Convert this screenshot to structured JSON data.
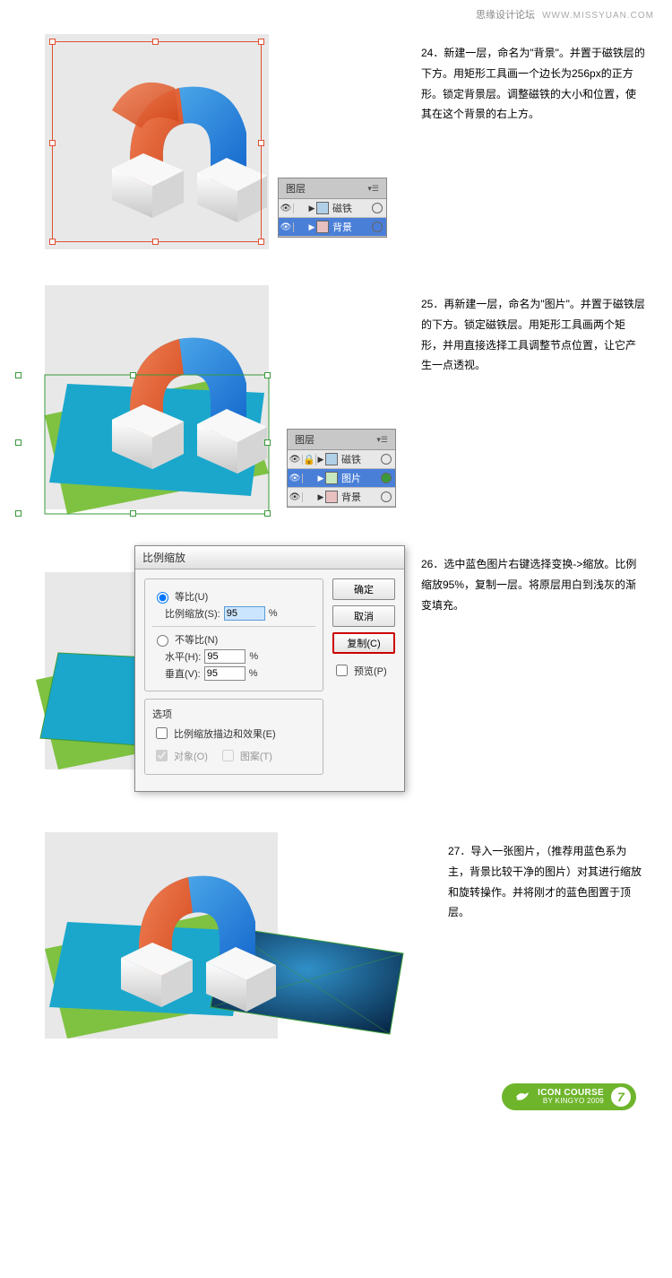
{
  "header": {
    "site_cn": "思缘设计论坛",
    "site_en": "WWW.MISSYUAN.COM"
  },
  "step24": {
    "num": "24．",
    "text": "新建一层，命名为\"背景\"。并置于磁铁层的下方。用矩形工具画一个边长为256px的正方形。锁定背景层。调整磁铁的大小和位置，使其在这个背景的右上方。",
    "layers_tab": "图层",
    "layers": [
      {
        "name": "磁铁"
      },
      {
        "name": "背景"
      }
    ]
  },
  "step25": {
    "num": "25．",
    "text": "再新建一层，命名为\"图片\"。并置于磁铁层的下方。锁定磁铁层。用矩形工具画两个矩形，并用直接选择工具调整节点位置，让它产生一点透视。",
    "layers_tab": "图层",
    "layers": [
      {
        "name": "磁铁"
      },
      {
        "name": "图片"
      },
      {
        "name": "背景"
      }
    ]
  },
  "step26": {
    "num": "26．",
    "text": "选中蓝色图片右键选择变换->缩放。比例缩放95%，复制一层。将原层用白到浅灰的渐变填充。",
    "dialog": {
      "title": "比例缩放",
      "uniform": "等比(U)",
      "scale_label": "比例缩放(S):",
      "scale_val": "95",
      "pct": "%",
      "nonuniform": "不等比(N)",
      "h_label": "水平(H):",
      "h_val": "95",
      "v_label": "垂直(V):",
      "v_val": "95",
      "options": "选项",
      "stroke_fx": "比例缩放描边和效果(E)",
      "objects": "对象(O)",
      "patterns": "图案(T)",
      "ok": "确定",
      "cancel": "取消",
      "copy": "复制(C)",
      "preview": "预览(P)"
    }
  },
  "step27": {
    "num": "27．",
    "text": "导入一张图片，（推荐用蓝色系为主，背景比较干净的图片）对其进行缩放和旋转操作。并将刚才的蓝色图置于顶层。"
  },
  "footer": {
    "title": "ICON COURSE",
    "sub": "BY KINGYO 2009",
    "page": "7"
  }
}
